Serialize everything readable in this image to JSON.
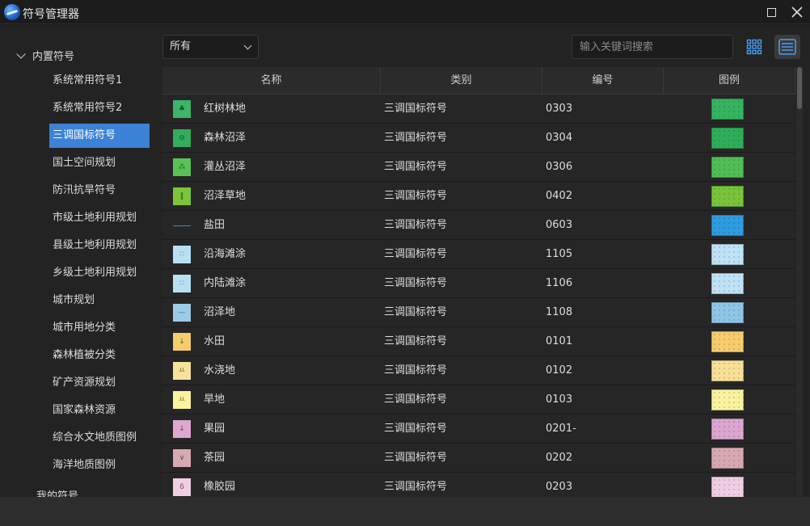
{
  "window": {
    "title": "符号管理器"
  },
  "sidebar": {
    "root_label": "内置符号",
    "items": [
      {
        "label": "系统常用符号1"
      },
      {
        "label": "系统常用符号2"
      },
      {
        "label": "三调国标符号",
        "active": true
      },
      {
        "label": "国土空间规划"
      },
      {
        "label": "防汛抗旱符号"
      },
      {
        "label": "市级土地利用规划"
      },
      {
        "label": "县级土地利用规划"
      },
      {
        "label": "乡级土地利用规划"
      },
      {
        "label": "城市规划"
      },
      {
        "label": "城市用地分类"
      },
      {
        "label": "森林植被分类"
      },
      {
        "label": "矿产资源规划"
      },
      {
        "label": "国家森林资源"
      },
      {
        "label": "综合水文地质图例"
      },
      {
        "label": "海洋地质图例"
      }
    ],
    "my_symbols_label": "我的符号"
  },
  "toolbar": {
    "filter_value": "所有",
    "search_placeholder": "输入关键词搜索"
  },
  "table": {
    "headers": [
      "名称",
      "类别",
      "编号",
      "图例"
    ],
    "rows": [
      {
        "name": "红树林地",
        "category": "三调国标符号",
        "code": "0303",
        "color": "#3bb567",
        "mark": "♣",
        "mark_color": "#0d5a27",
        "legend_color": "#35b460"
      },
      {
        "name": "森林沼泽",
        "category": "三调国标符号",
        "code": "0304",
        "color": "#33ad5b",
        "mark": "⊖",
        "mark_color": "#0d5a27",
        "legend_color": "#2fae5a"
      },
      {
        "name": "灌丛沼泽",
        "category": "三调国标符号",
        "code": "0306",
        "color": "#59c257",
        "mark": "⁂",
        "mark_color": "#1e6a1e",
        "legend_color": "#4fbf55"
      },
      {
        "name": "沼泽草地",
        "category": "三调国标符号",
        "code": "0402",
        "color": "#7cc53a",
        "mark": "‖",
        "mark_color": "#2a5a10",
        "legend_color": "#78c33a"
      },
      {
        "name": "盐田",
        "category": "三调国标符号",
        "code": "0603",
        "color": "",
        "mark": "",
        "mark_color": "#2f8fd6",
        "legend_color": "#2f9be0"
      },
      {
        "name": "沿海滩涂",
        "category": "三调国标符号",
        "code": "1105",
        "color": "#b9dff2",
        "mark": "∷",
        "mark_color": "#4a7a99",
        "legend_color": "#bfe2f5"
      },
      {
        "name": "内陆滩涂",
        "category": "三调国标符号",
        "code": "1106",
        "color": "#b9dff2",
        "mark": "∷",
        "mark_color": "#4a7a99",
        "legend_color": "#bfe2f5"
      },
      {
        "name": "沼泽地",
        "category": "三调国标符号",
        "code": "1108",
        "color": "#9ccbe6",
        "mark": "—",
        "mark_color": "#2b6fb0",
        "legend_color": "#8fc6e8"
      },
      {
        "name": "水田",
        "category": "三调国标符号",
        "code": "0101",
        "color": "#f7cc6a",
        "mark": "↓",
        "mark_color": "#1e7a2e",
        "legend_color": "#f6cd6e"
      },
      {
        "name": "水浇地",
        "category": "三调国标符号",
        "code": "0102",
        "color": "#f8e29a",
        "mark": "ㅛ",
        "mark_color": "#7a6a20",
        "legend_color": "#f7df96"
      },
      {
        "name": "旱地",
        "category": "三调国标符号",
        "code": "0103",
        "color": "#fbf29f",
        "mark": "ㅛ",
        "mark_color": "#7a6a20",
        "legend_color": "#fbf2a0"
      },
      {
        "name": "果园",
        "category": "三调国标符号",
        "code": "0201-",
        "color": "#dda8d0",
        "mark": "↓",
        "mark_color": "#7a2a6a",
        "legend_color": "#dba6cf"
      },
      {
        "name": "茶园",
        "category": "三调国标符号",
        "code": "0202",
        "color": "#d9a9b3",
        "mark": "∨",
        "mark_color": "#2a6a2a",
        "legend_color": "#d8a8b2"
      },
      {
        "name": "橡胶园",
        "category": "三调国标符号",
        "code": "0203",
        "color": "#f1cfe3",
        "mark": "δ",
        "mark_color": "#7a2a6a",
        "legend_color": "#f0cde2"
      }
    ]
  }
}
